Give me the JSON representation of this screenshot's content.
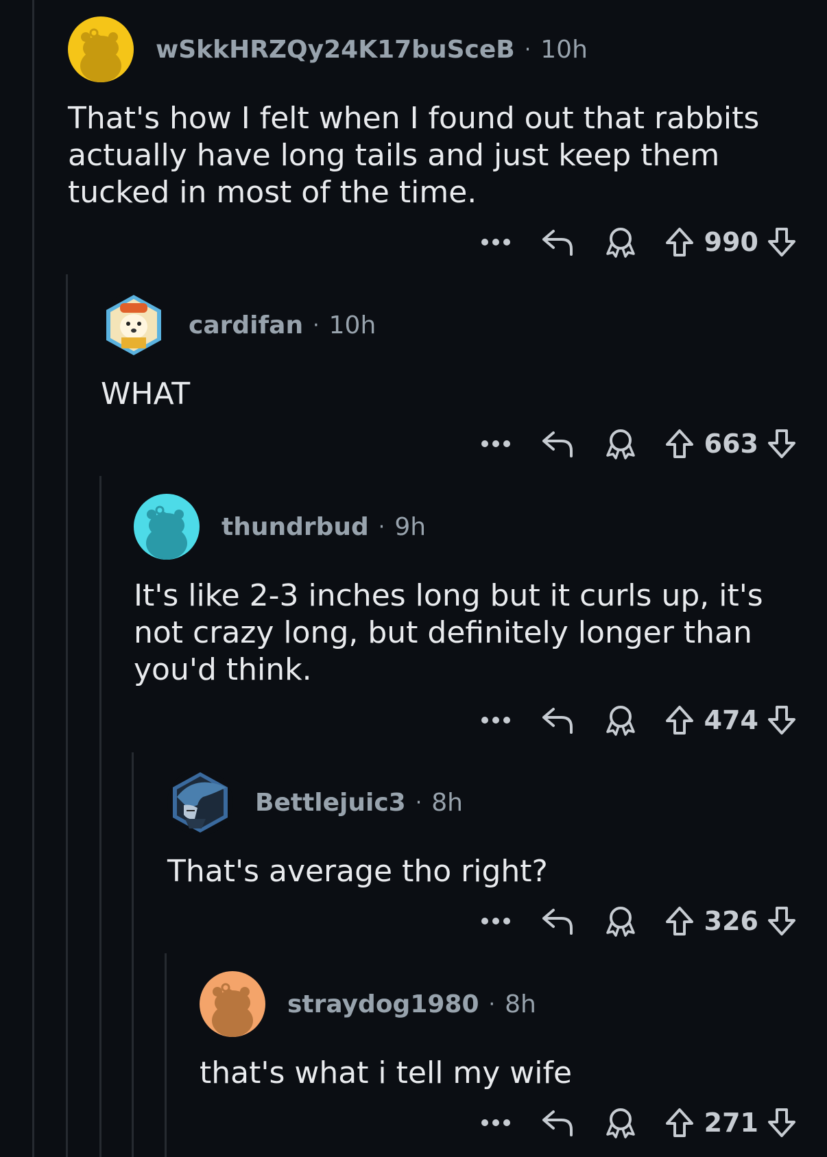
{
  "comments": [
    {
      "username": "wSkkHRZQy24K17buSceB",
      "time": "10h",
      "body": "That's how I felt when I found out that rabbits actually have long tails and just keep them tucked in most of the time.",
      "score": "990",
      "avatar_color": "#f5c518",
      "avatar_icon": "snoo-avatar-icon"
    },
    {
      "username": "cardifan",
      "time": "10h",
      "body": "WHAT",
      "score": "663",
      "avatar_color": "#5bb3e0",
      "avatar_icon": "dog-nft-avatar-icon"
    },
    {
      "username": "thundrbud",
      "time": "9h",
      "body": "It's like 2-3 inches long but it curls up, it's not crazy long, but definitely longer than you'd think.",
      "score": "474",
      "avatar_color": "#4ddbe8",
      "avatar_icon": "snoo-avatar-icon"
    },
    {
      "username": "Bettlejuic3",
      "time": "8h",
      "body": "That's average tho right?",
      "score": "326",
      "avatar_color": "#3a6a9e",
      "avatar_icon": "alien-nft-avatar-icon"
    },
    {
      "username": "straydog1980",
      "time": "8h",
      "body": "that's what i tell my wife",
      "score": "271",
      "avatar_color": "#f4a46a",
      "avatar_icon": "snoo-avatar-icon"
    }
  ],
  "separator": "·",
  "icons": {
    "more": "more-options-icon",
    "reply": "reply-icon",
    "award": "award-icon",
    "upvote": "upvote-arrow-icon",
    "downvote": "downvote-arrow-icon"
  }
}
